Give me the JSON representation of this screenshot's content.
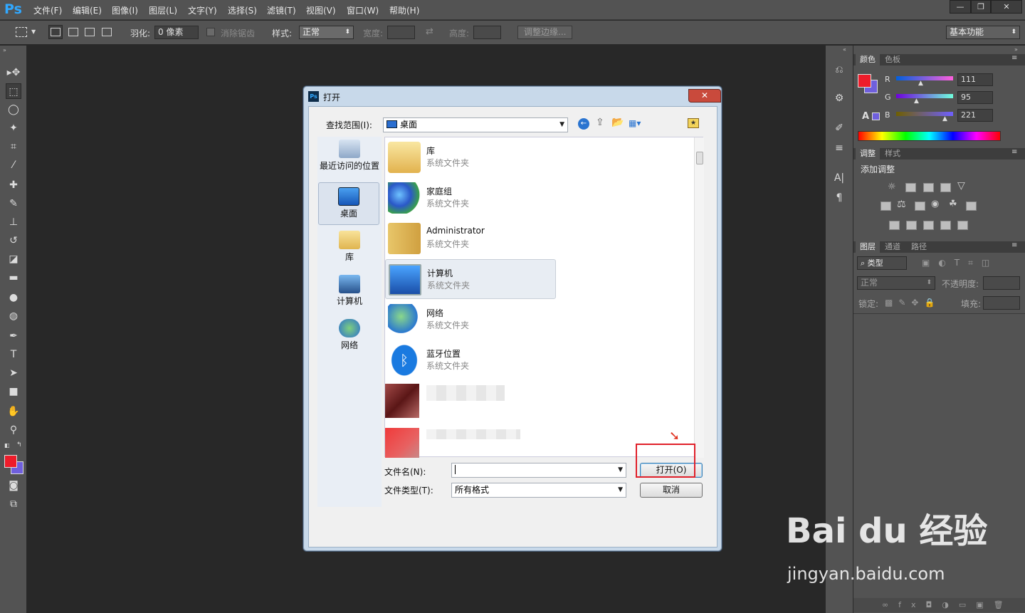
{
  "app": {
    "logo": "Ps"
  },
  "menu": [
    "文件(F)",
    "编辑(E)",
    "图像(I)",
    "图层(L)",
    "文字(Y)",
    "选择(S)",
    "滤镜(T)",
    "视图(V)",
    "窗口(W)",
    "帮助(H)"
  ],
  "window_controls": {
    "minimize": "—",
    "restore": "❐",
    "close": "✕"
  },
  "options": {
    "feather_label": "羽化:",
    "feather_value": "0 像素",
    "antialias_label": "消除锯齿",
    "style_label": "样式:",
    "style_value": "正常",
    "width_label": "宽度:",
    "height_label": "高度:",
    "refine_edge": "调整边缘...",
    "workspace": "基本功能"
  },
  "color_panel": {
    "tabs": [
      "颜色",
      "色板"
    ],
    "r_label": "R",
    "g_label": "G",
    "b_label": "B",
    "r": "111",
    "g": "95",
    "b": "221",
    "foreground": "#ee1c2a",
    "background": "#6f5fdd"
  },
  "adjust_panel": {
    "tabs": [
      "调整",
      "样式"
    ],
    "title": "添加调整"
  },
  "layers_panel": {
    "tabs": [
      "图层",
      "通道",
      "路径"
    ],
    "filter_kind": "类型",
    "blend_mode": "正常",
    "opacity_label": "不透明度:",
    "lock_label": "锁定:",
    "fill_label": "填充:"
  },
  "dialog": {
    "title": "打开",
    "lookin_label": "查找范围(I):",
    "lookin_value": "桌面",
    "places": [
      "最近访问的位置",
      "桌面",
      "库",
      "计算机",
      "网络"
    ],
    "items": [
      {
        "name": "库",
        "type": "系统文件夹"
      },
      {
        "name": "家庭组",
        "type": "系统文件夹"
      },
      {
        "name": "Administrator",
        "type": "系统文件夹"
      },
      {
        "name": "计算机",
        "type": "系统文件夹"
      },
      {
        "name": "网络",
        "type": "系统文件夹"
      },
      {
        "name": "蓝牙位置",
        "type": "系统文件夹"
      }
    ],
    "filename_label": "文件名(N):",
    "filetype_label": "文件类型(T):",
    "filetype_value": "所有格式",
    "open_button": "打开(O)",
    "cancel_button": "取消"
  },
  "watermark": {
    "logo_text": "Bai du 经验",
    "url": "jingyan.baidu.com"
  }
}
